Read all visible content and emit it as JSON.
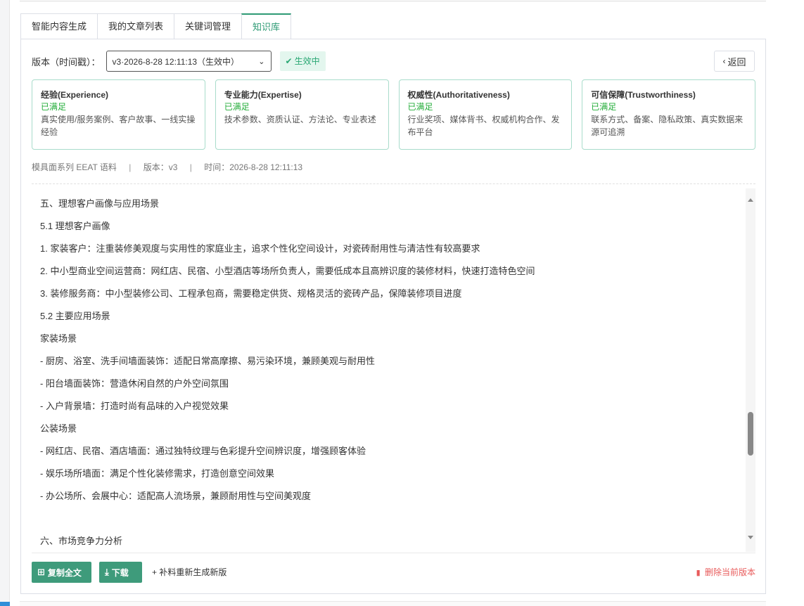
{
  "tabs": [
    {
      "label": "智能内容生成"
    },
    {
      "label": "我的文章列表"
    },
    {
      "label": "关键词管理"
    },
    {
      "label": "知识库"
    }
  ],
  "version": {
    "label": "版本（时间戳）：",
    "selected": "v3·2026-8-28 12:11:13（生效中）",
    "status_badge": "生效中"
  },
  "back_label": "返回",
  "eeat_cards": [
    {
      "title": "经验(Experience)",
      "status": "已满足",
      "desc": "真实使用/服务案例、客户故事、一线实操经验"
    },
    {
      "title": "专业能力(Expertise)",
      "status": "已满足",
      "desc": "技术参数、资质认证、方法论、专业表述"
    },
    {
      "title": "权威性(Authoritativeness)",
      "status": "已满足",
      "desc": "行业奖项、媒体背书、权威机构合作、发布平台"
    },
    {
      "title": "可信保障(Trustworthiness)",
      "status": "已满足",
      "desc": "联系方式、备案、隐私政策、真实数据来源可追溯"
    }
  ],
  "meta": {
    "corpus": "模具面系列 EEAT 语料",
    "version": "版本：v3",
    "time": "时间：2026-8-28 12:11:13",
    "sep": "|"
  },
  "content_lines": [
    "五、理想客户画像与应用场景",
    "5.1 理想客户画像",
    "1. 家装客户：注重装修美观度与实用性的家庭业主，追求个性化空间设计，对瓷砖耐用性与清洁性有较高要求",
    "2. 中小型商业空间运营商：网红店、民宿、小型酒店等场所负责人，需要低成本且高辨识度的装修材料，快速打造特色空间",
    "3. 装修服务商：中小型装修公司、工程承包商，需要稳定供货、规格灵活的瓷砖产品，保障装修项目进度",
    "5.2 主要应用场景",
    "家装场景",
    "- 厨房、浴室、洗手间墙面装饰：适配日常高摩擦、易污染环境，兼顾美观与耐用性",
    "- 阳台墙面装饰：营造休闲自然的户外空间氛围",
    "- 入户背景墙：打造时尚有品味的入户视觉效果",
    "公装场景",
    "- 网红店、民宿、酒店墙面：通过独特纹理与色彩提升空间辨识度，增强顾客体验",
    "- 娱乐场所墙面：满足个性化装修需求，打造创意空间效果",
    "- 办公场所、会展中心：适配高人流场景，兼顾耐用性与空间美观度",
    "",
    "六、市场竞争力分析"
  ],
  "footer": {
    "copy_label": "复制全文",
    "download_label": "下载",
    "regen_label": "+ 补料重新生成新版",
    "delete_label": "删除当前版本"
  },
  "colors": {
    "accent": "#2d9a74",
    "button_green": "#3e9b7b",
    "success": "#22ac38",
    "danger": "#e85a5a",
    "card_border": "#a9dccb"
  }
}
